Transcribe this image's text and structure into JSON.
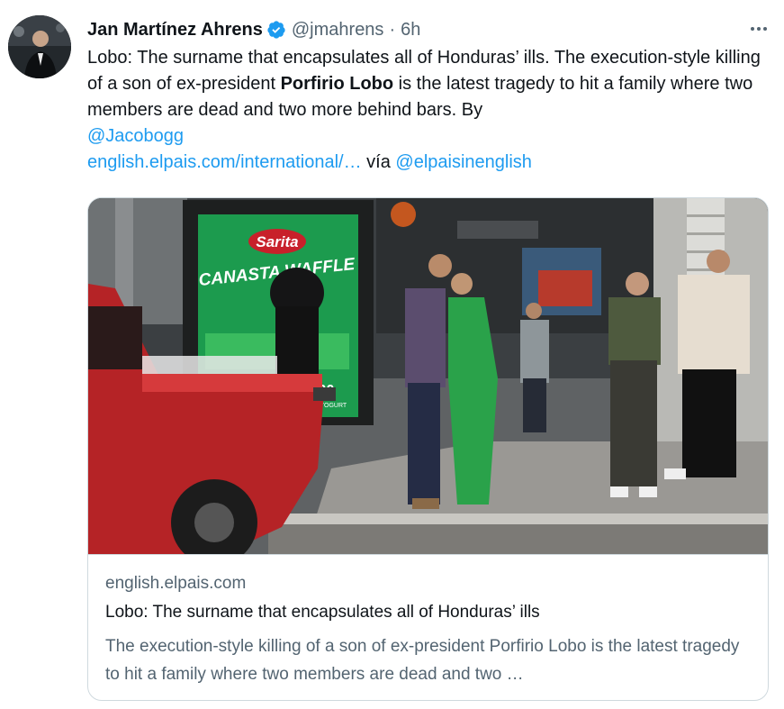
{
  "author": {
    "name": "Jan Martínez Ahrens",
    "handle": "@jmahrens",
    "separator": "·",
    "time": "6h",
    "avatar_icon": "person-avatar",
    "verified_icon": "verified-badge-icon"
  },
  "tweet": {
    "text_1": "Lobo: The surname that encapsulates all of Honduras’ ills. The execution-style killing of a son of ex-president ",
    "bold_name": "Porfirio Lobo",
    "text_2": " is the latest tragedy to hit a family where two members are dead and two more behind bars. By ",
    "mention": "@Jacobogg",
    "url": "english.elpais.com/international/…",
    "via_label": " vía ",
    "via_account": "@elpaisinenglish"
  },
  "card": {
    "domain": "english.elpais.com",
    "title": "Lobo: The surname that encapsulates all of Honduras’ ills",
    "description": "The execution-style killing of a son of ex-president Porfirio Lobo is the latest tragedy to hit a family where two members are dead and two …",
    "billboard_brand": "Sarita",
    "billboard_text": "CANASTA WAFFLE",
    "billboard_sub": "100",
    "billboard_sub2": "ZEEN YOGURT"
  },
  "colors": {
    "link": "#1d9bf0",
    "secondary_text": "#536471",
    "verified": "#1d9bf0",
    "truck": "#b52326",
    "dress": "#2aa24a"
  }
}
